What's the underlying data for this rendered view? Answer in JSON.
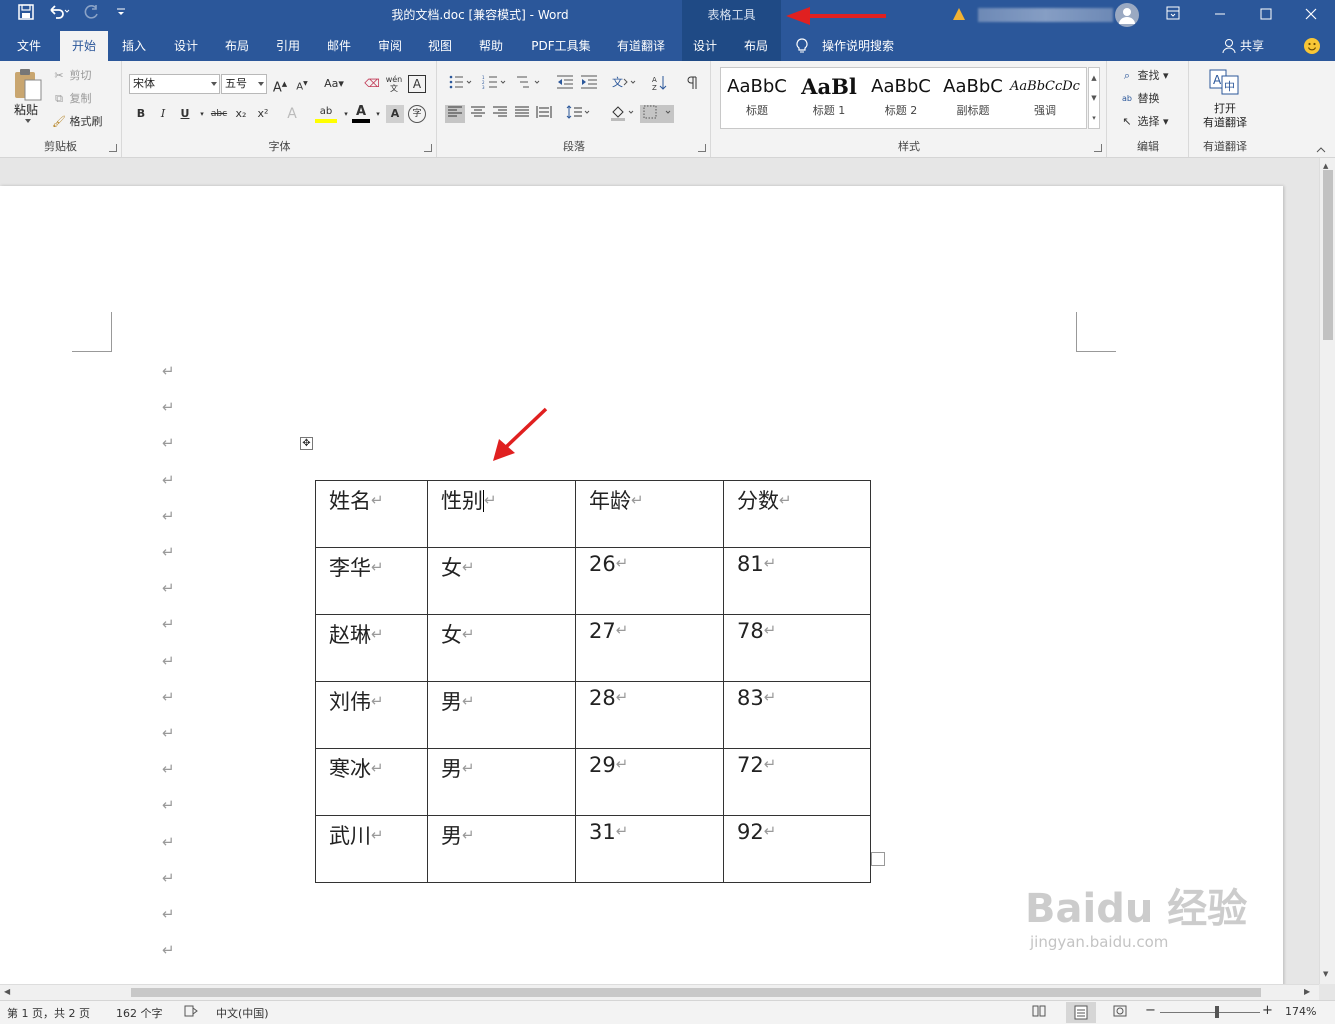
{
  "titlebar": {
    "doc_title": "我的文档.doc [兼容模式]  -  Word",
    "contextual_title": "表格工具",
    "undo_icon": "undo-icon",
    "redo_icon": "redo-icon",
    "save_icon": "save-icon"
  },
  "tabs": [
    {
      "label": "文件"
    },
    {
      "label": "开始"
    },
    {
      "label": "插入"
    },
    {
      "label": "设计"
    },
    {
      "label": "布局"
    },
    {
      "label": "引用"
    },
    {
      "label": "邮件"
    },
    {
      "label": "审阅"
    },
    {
      "label": "视图"
    },
    {
      "label": "帮助"
    },
    {
      "label": "PDF工具集"
    },
    {
      "label": "有道翻译"
    },
    {
      "label": "设计"
    },
    {
      "label": "布局"
    }
  ],
  "tell_me": "操作说明搜索",
  "share": "共享",
  "clipboard": {
    "paste": "粘贴",
    "cut": "剪切",
    "copy": "复制",
    "format_painter": "格式刷",
    "group_label": "剪贴板"
  },
  "font": {
    "font_name": "宋体",
    "font_size": "五号",
    "change_case": "Aa",
    "phonetic": "wén",
    "group_label": "字体",
    "bold": "B",
    "italic": "I",
    "underline": "U",
    "strike": "abc",
    "subscript": "x₂",
    "superscript": "x²",
    "grow": "A",
    "shrink": "A",
    "border_char": "A",
    "text_effect": "A",
    "highlight": "ab",
    "font_color": "A",
    "shading": "A",
    "enclose": "字"
  },
  "paragraph": {
    "group_label": "段落"
  },
  "styles": {
    "items": [
      {
        "sample": "AaBbC",
        "name": "标题"
      },
      {
        "sample": "AaBl",
        "name": "标题 1"
      },
      {
        "sample": "AaBbC",
        "name": "标题 2"
      },
      {
        "sample": "AaBbC",
        "name": "副标题"
      },
      {
        "sample": "AaBbCcDc",
        "name": "强调"
      }
    ],
    "group_label": "样式"
  },
  "editing": {
    "find": "查找",
    "replace": "替换",
    "select": "选择",
    "group_label": "编辑"
  },
  "youdao": {
    "open_line1": "打开",
    "open_line2": "有道翻译",
    "group_label": "有道翻译"
  },
  "table": {
    "rows": [
      [
        "姓名",
        "性别",
        "年龄",
        "分数"
      ],
      [
        "李华",
        "女",
        "26",
        "81"
      ],
      [
        "赵琳",
        "女",
        "27",
        "78"
      ],
      [
        "刘伟",
        "男",
        "28",
        "83"
      ],
      [
        "寒冰",
        "男",
        "29",
        "72"
      ],
      [
        "武川",
        "男",
        "31",
        "92"
      ]
    ]
  },
  "paragraph_mark": "↵",
  "status": {
    "page": "第 1 页，共 2 页",
    "words": "162 个字",
    "language": "中文(中国)",
    "zoom": "174%"
  },
  "watermark": "Baidu 经验",
  "watermark_url": "jingyan.baidu.com",
  "colors": {
    "brand": "#2b579a",
    "ribbon": "#f3f3f3",
    "annotation_arrow": "#e02020"
  }
}
